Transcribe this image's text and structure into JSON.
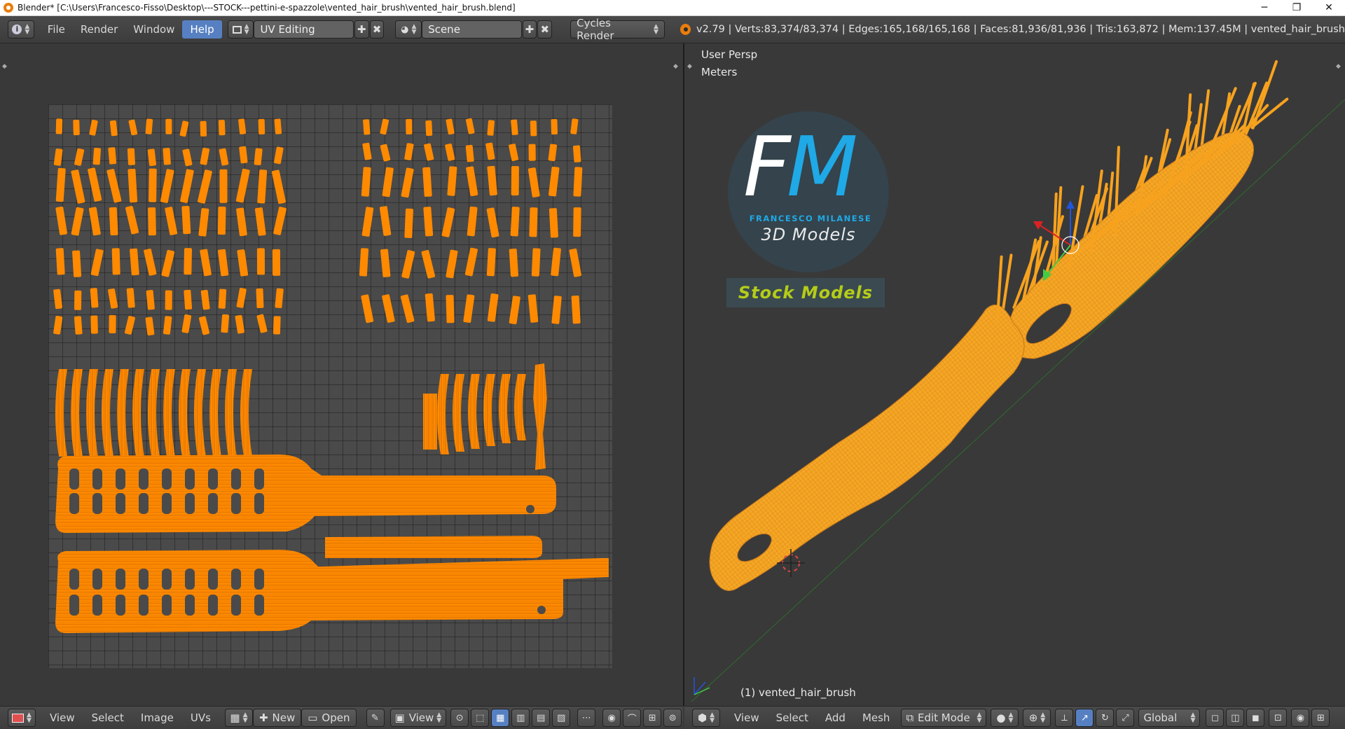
{
  "window": {
    "title": "Blender* [C:\\Users\\Francesco-Fisso\\Desktop\\---STOCK---pettini-e-spazzole\\vented_hair_brush\\vented_hair_brush.blend]",
    "minimize": "─",
    "restore": "❐",
    "close": "✕"
  },
  "info_header": {
    "menus": [
      "File",
      "Render",
      "Window",
      "Help"
    ],
    "active_menu": "Help",
    "screen_layout": "UV Editing",
    "scene": "Scene",
    "render_engine": "Cycles Render",
    "stats": "v2.79 | Verts:83,374/83,374 | Edges:165,168/165,168 | Faces:81,936/81,936 | Tris:163,872 | Mem:137.45M | vented_hair_brush"
  },
  "uv_editor": {
    "menus": [
      "View",
      "Select",
      "Image",
      "UVs"
    ],
    "new_label": "New",
    "open_label": "Open",
    "view_label": "View"
  },
  "viewport": {
    "perspective": "User Persp",
    "units": "Meters",
    "object_label": "(1) vented_hair_brush",
    "menus": [
      "View",
      "Select",
      "Add",
      "Mesh"
    ],
    "mode": "Edit Mode",
    "orientation": "Global"
  },
  "logo": {
    "letter_f": "F",
    "letter_m": "M",
    "name": "FRANCESCO MILANESE",
    "subtitle": "3D Models",
    "tagline": "Stock Models"
  },
  "colors": {
    "uv_island": "#ff8a00",
    "mesh": "#f7a21e",
    "accent": "#5680c2"
  }
}
